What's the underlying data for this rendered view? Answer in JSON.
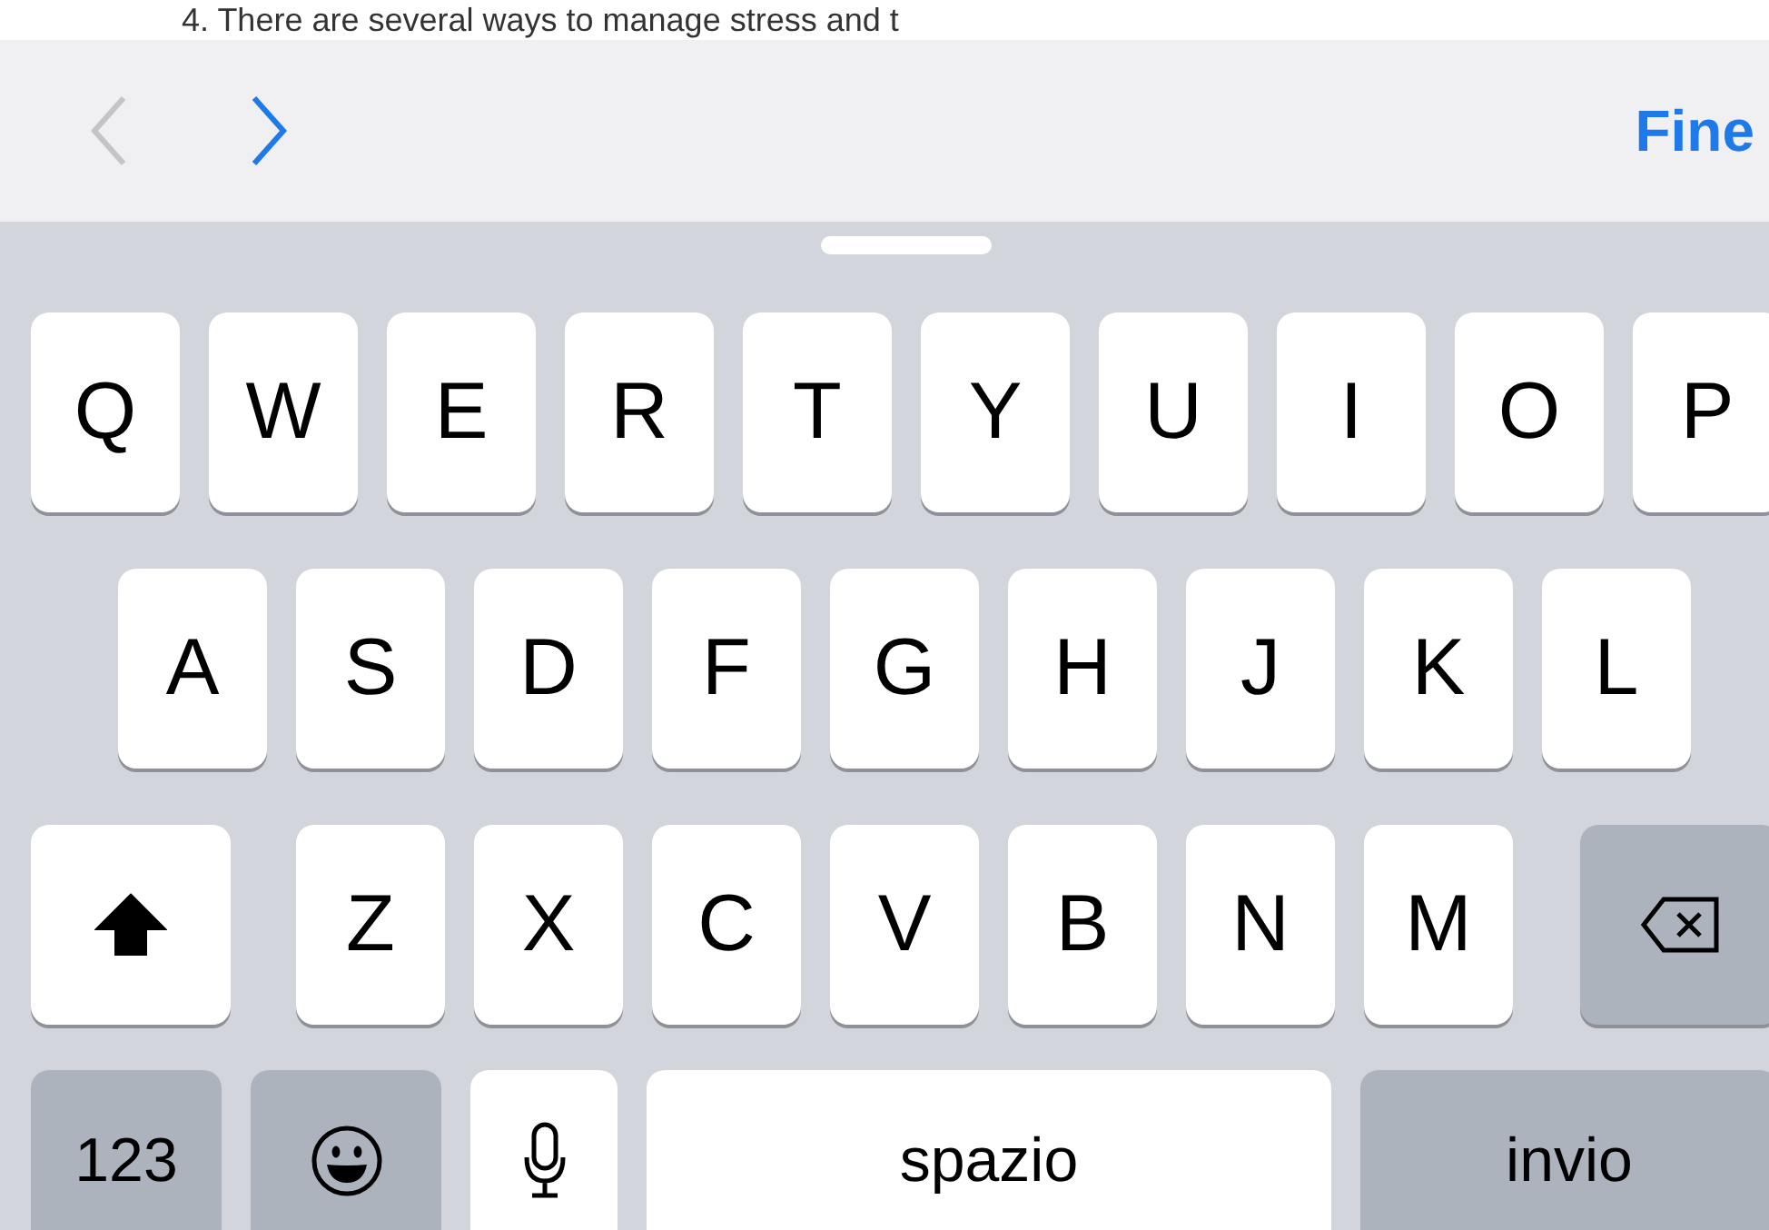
{
  "document_text": "4. There are several ways to manage stress and t",
  "toolbar": {
    "buttons": [
      {
        "kind": "previous",
        "disabled": true
      },
      {
        "kind": "next",
        "disabled": false
      }
    ],
    "done": "Fine"
  },
  "keyboard": {
    "top_row": [
      {
        "kind": "letter",
        "label": "Q"
      },
      {
        "kind": "letter",
        "label": "W"
      },
      {
        "kind": "letter",
        "label": "E"
      },
      {
        "kind": "letter",
        "label": "R"
      },
      {
        "kind": "letter",
        "label": "T"
      },
      {
        "kind": "letter",
        "label": "Y"
      },
      {
        "kind": "letter",
        "label": "U"
      },
      {
        "kind": "letter",
        "label": "I"
      },
      {
        "kind": "letter",
        "label": "O"
      },
      {
        "kind": "letter",
        "label": "P"
      }
    ],
    "middle_row": [
      {
        "kind": "letter",
        "label": "A"
      },
      {
        "kind": "letter",
        "label": "S"
      },
      {
        "kind": "letter",
        "label": "D"
      },
      {
        "kind": "letter",
        "label": "F"
      },
      {
        "kind": "letter",
        "label": "G"
      },
      {
        "kind": "letter",
        "label": "H"
      },
      {
        "kind": "letter",
        "label": "J"
      },
      {
        "kind": "letter",
        "label": "K"
      },
      {
        "kind": "letter",
        "label": "L"
      }
    ],
    "lower_row": [
      {
        "kind": "shift",
        "on": true
      },
      {
        "kind": "letter",
        "label": "Z"
      },
      {
        "kind": "letter",
        "label": "X"
      },
      {
        "kind": "letter",
        "label": "C"
      },
      {
        "kind": "letter",
        "label": "V"
      },
      {
        "kind": "letter",
        "label": "B"
      },
      {
        "kind": "letter",
        "label": "N"
      },
      {
        "kind": "letter",
        "label": "M"
      },
      {
        "kind": "backspace"
      }
    ],
    "function_row": [
      {
        "kind": "numbers",
        "label": "123"
      },
      {
        "kind": "emoji"
      },
      {
        "kind": "mic"
      },
      {
        "kind": "space",
        "label": "spazio"
      },
      {
        "kind": "return",
        "label": "invio"
      }
    ]
  }
}
